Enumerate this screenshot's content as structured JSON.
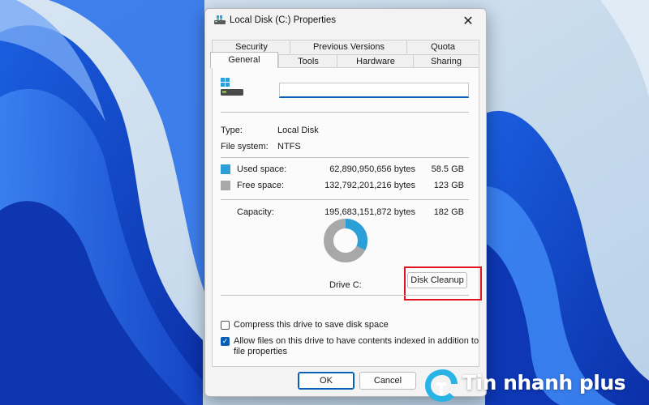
{
  "window": {
    "title": "Local Disk (C:) Properties",
    "close_glyph": "✕"
  },
  "tabs": {
    "row1": [
      "Security",
      "Previous Versions",
      "Quota"
    ],
    "row2": [
      "General",
      "Tools",
      "Hardware",
      "Sharing"
    ],
    "active": "General"
  },
  "general": {
    "name_value": "",
    "type_label": "Type:",
    "type_value": "Local Disk",
    "fs_label": "File system:",
    "fs_value": "NTFS",
    "used": {
      "label": "Used space:",
      "bytes": "62,890,950,656 bytes",
      "size": "58.5 GB",
      "color": "#2b9fd8"
    },
    "free": {
      "label": "Free space:",
      "bytes": "132,792,201,216 bytes",
      "size": "123 GB",
      "color": "#a8a8a8"
    },
    "capacity": {
      "label": "Capacity:",
      "bytes": "195,683,151,872 bytes",
      "size": "182 GB"
    },
    "used_fraction": 0.321,
    "drive_label": "Drive C:",
    "cleanup_label": "Disk Cleanup",
    "compress_label": "Compress this drive to save disk space",
    "compress_checked": false,
    "index_label_line1": "Allow files on this drive to have contents indexed in addition to",
    "index_label_line2": "file properties",
    "index_checked": true
  },
  "buttons": {
    "ok": "OK",
    "cancel": "Cancel"
  },
  "watermark": {
    "text": "Tin nhanh plus"
  },
  "icons": [
    "windows-logo-icon",
    "drive-icon",
    "close-icon",
    "checkmark-icon",
    "watermark-logo-icon"
  ]
}
